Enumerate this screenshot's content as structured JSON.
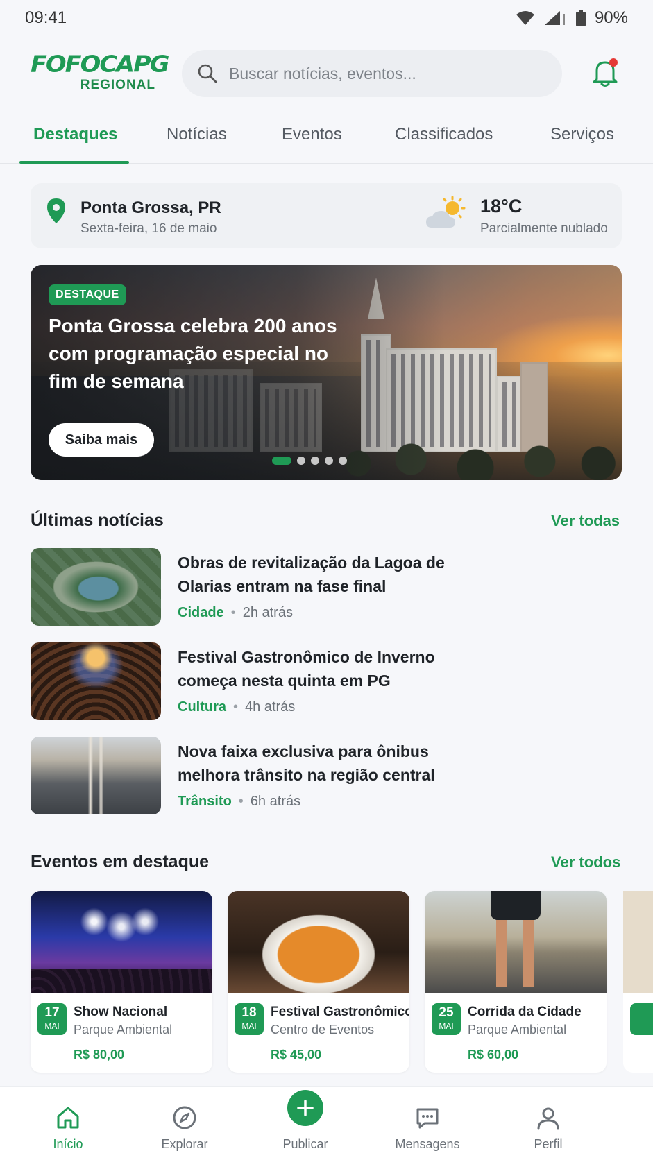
{
  "status_bar": {
    "time": "09:41",
    "battery": "90%"
  },
  "header": {
    "logo_main": "FOFOCAPG",
    "logo_sub": "REGIONAL",
    "search_placeholder": "Buscar notícias, eventos..."
  },
  "tabs": [
    "Destaques",
    "Notícias",
    "Eventos",
    "Classificados",
    "Serviços"
  ],
  "active_tab": "Destaques",
  "location": {
    "city": "Ponta Grossa, PR",
    "date": "Sexta-feira, 16 de maio",
    "temperature": "18°C",
    "condition": "Parcialmente nublado"
  },
  "hero": {
    "badge": "DESTAQUE",
    "title": "Ponta Grossa celebra 200 anos com programação especial no fim de semana",
    "button": "Saiba mais",
    "slide_count": 5,
    "active_slide": 1
  },
  "latest_news": {
    "title": "Últimas notícias",
    "see_all": "Ver todas",
    "items": [
      {
        "title": "Obras de revitalização da Lagoa de Olarias entram na fase final",
        "category": "Cidade",
        "time": "2h atrás"
      },
      {
        "title": "Festival Gastronômico de Inverno começa nesta quinta em PG",
        "category": "Cultura",
        "time": "4h atrás"
      },
      {
        "title": "Nova faixa exclusiva para ônibus melhora trânsito na região central",
        "category": "Trânsito",
        "time": "6h atrás"
      }
    ]
  },
  "featured_events": {
    "title": "Eventos em destaque",
    "see_all": "Ver todos",
    "items": [
      {
        "day": "17",
        "month": "MAI",
        "name": "Show Nacional",
        "venue": "Parque Ambiental",
        "price": "R$ 80,00"
      },
      {
        "day": "18",
        "month": "MAI",
        "name": "Festival Gastronômico",
        "venue": "Centro de Eventos",
        "price": "R$ 45,00"
      },
      {
        "day": "25",
        "month": "MAI",
        "name": "Corrida da Cidade",
        "venue": "Parque Ambiental",
        "price": "R$ 60,00"
      }
    ]
  },
  "bottom_nav": [
    "Início",
    "Explorar",
    "Publicar",
    "Mensagens",
    "Perfil"
  ],
  "colors": {
    "accent": "#1f9a55",
    "background": "#f6f7fa",
    "notification_dot": "#e53935"
  }
}
